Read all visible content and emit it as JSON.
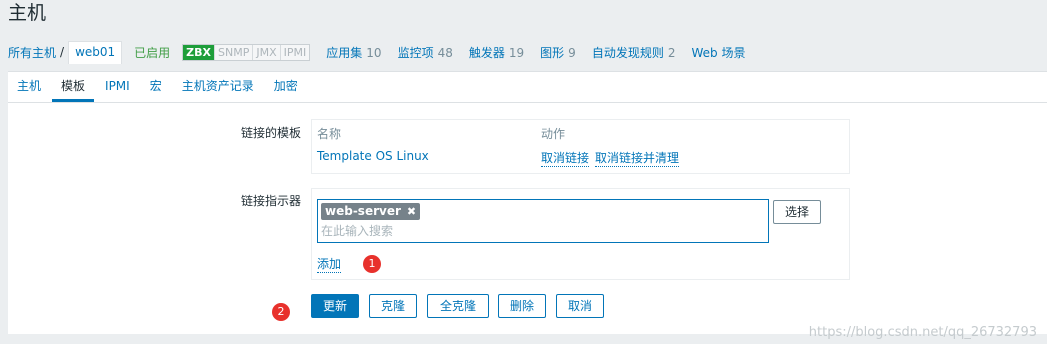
{
  "page": {
    "title": "主机"
  },
  "breadcrumb": {
    "all_hosts": "所有主机",
    "separator": "/",
    "current": "web01"
  },
  "status": {
    "enabled": "已启用"
  },
  "availability": [
    "ZBX",
    "SNMP",
    "JMX",
    "IPMI"
  ],
  "host_nav": [
    {
      "label": "应用集",
      "count": "10"
    },
    {
      "label": "监控项",
      "count": "48"
    },
    {
      "label": "触发器",
      "count": "19"
    },
    {
      "label": "图形",
      "count": "9"
    },
    {
      "label": "自动发现规则",
      "count": "2"
    },
    {
      "label": "Web 场景",
      "count": ""
    }
  ],
  "tabs": [
    {
      "label": "主机",
      "active": false
    },
    {
      "label": "模板",
      "active": true
    },
    {
      "label": "IPMI",
      "active": false
    },
    {
      "label": "宏",
      "active": false
    },
    {
      "label": "主机资产记录",
      "active": false
    },
    {
      "label": "加密",
      "active": false
    }
  ],
  "linked_templates": {
    "label": "链接的模板",
    "col_name": "名称",
    "col_action": "动作",
    "rows": [
      {
        "name": "Template OS Linux",
        "unlink": "取消链接",
        "unlink_clear": "取消链接并清理"
      }
    ]
  },
  "link_new": {
    "label": "链接指示器",
    "chip": "web-server",
    "placeholder": "在此输入搜索",
    "select_label": "选择",
    "add_label": "添加"
  },
  "annotations": {
    "one": "1",
    "two": "2"
  },
  "buttons": {
    "update": "更新",
    "clone": "克隆",
    "full_clone": "全克隆",
    "delete": "删除",
    "cancel": "取消"
  },
  "watermark": "https://blog.csdn.net/qq_26732793",
  "colors": {
    "accent": "#0275b8",
    "enabled": "#429e47",
    "zbx": "#1e9e3a",
    "badge": "#e8312c"
  }
}
